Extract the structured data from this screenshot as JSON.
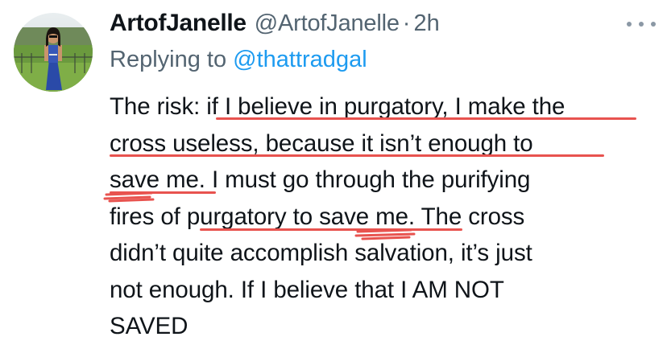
{
  "author": {
    "display_name": "ArtofJanelle",
    "handle": "@ArtofJanelle",
    "separator": "·",
    "time": "2h"
  },
  "reply": {
    "prefix": "Replying to",
    "mention": "@thattradgal"
  },
  "tweet_lines": [
    "The risk: if I believe in purgatory, I make the",
    "cross useless, because it isn’t enough to",
    "save me. I must go through the purifying",
    "fires of purgatory to save me. The cross",
    "didn’t quite accomplish salvation, it’s just",
    "not enough. If I believe that I AM NOT",
    "SAVED"
  ],
  "icons": {
    "more": "more-horizontal-icon",
    "avatar": "profile-photo"
  },
  "colors": {
    "text": "#0f1419",
    "secondary": "#536471",
    "link": "#1d9bf0",
    "annotation": "#e8534f"
  }
}
